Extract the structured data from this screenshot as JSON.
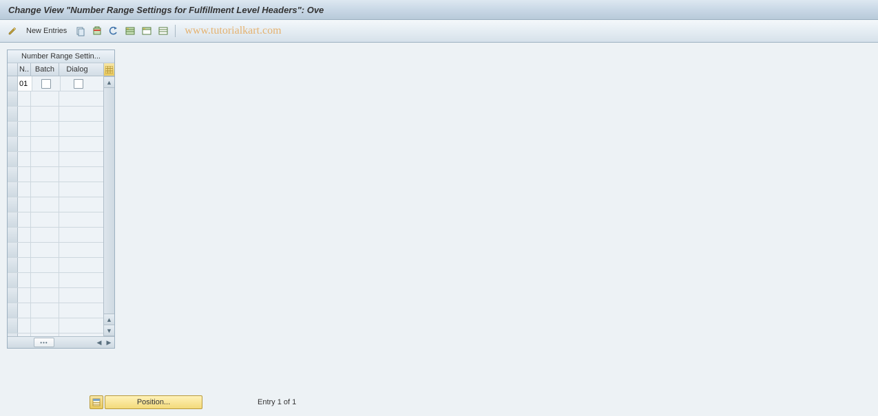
{
  "title": "Change View \"Number Range Settings for Fulfillment Level Headers\": Ove",
  "toolbar": {
    "new_entries": "New Entries"
  },
  "watermark": "www.tutorialkart.com",
  "grid": {
    "title": "Number Range Settin...",
    "columns": {
      "n": "N..",
      "batch": "Batch",
      "dialog": "Dialog"
    },
    "rows": [
      {
        "n": "01",
        "batch": false,
        "dialog": false
      }
    ],
    "empty_row_count": 17
  },
  "footer": {
    "position_label": "Position...",
    "entry_text": "Entry 1 of 1"
  }
}
